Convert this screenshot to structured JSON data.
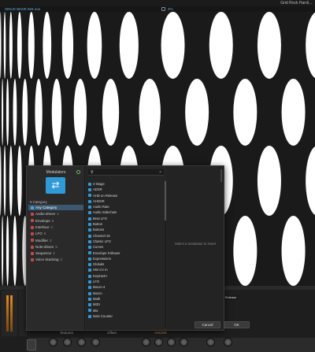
{
  "app": {
    "brand": "Grid Rock Hardi..."
  },
  "track": {
    "name": "SINUS WAVE 5e6 ooo",
    "percent": "2%"
  },
  "dialog": {
    "title": "Modulators",
    "categories_header": "Category",
    "categories": [
      {
        "label": "Any Category",
        "count": "",
        "selected": true,
        "icon": "all-icon"
      },
      {
        "label": "Audio-driven",
        "count": "4",
        "selected": false,
        "icon": "category-icon"
      },
      {
        "label": "Envelope",
        "count": "6",
        "selected": false,
        "icon": "category-icon"
      },
      {
        "label": "Interface",
        "count": "2",
        "selected": false,
        "icon": "category-icon"
      },
      {
        "label": "LFO",
        "count": "6",
        "selected": false,
        "icon": "category-icon"
      },
      {
        "label": "Modifier",
        "count": "3",
        "selected": false,
        "icon": "category-icon"
      },
      {
        "label": "Note-driven",
        "count": "9",
        "selected": false,
        "icon": "category-icon"
      },
      {
        "label": "Sequence",
        "count": "2",
        "selected": false,
        "icon": "category-icon"
      },
      {
        "label": "Voice Stacking",
        "count": "2",
        "selected": false,
        "icon": "category-icon"
      }
    ],
    "search": {
      "value": "",
      "placeholder": ""
    },
    "modulators": [
      "4-Stage",
      "ADSR",
      "AHD on Release",
      "AHDSR",
      "Audio Rate",
      "Audio Sidechain",
      "Beat LFO",
      "Button",
      "Buttons",
      "Channel-16",
      "Classic LFO",
      "Curves",
      "Envelope Follower",
      "Expressions",
      "Globals",
      "HW CV In",
      "Keytrack+",
      "LFO",
      "Macro-4",
      "Macro",
      "Math",
      "MIDI",
      "Mix",
      "Note Counter"
    ],
    "detail_hint": "Select a modulator to insert",
    "cancel_label": "Cancel",
    "ok_label": "OK"
  },
  "dock": {
    "release_label": "Release",
    "textures_label": "Textures",
    "voice_label": "Voices",
    "knob_labels": [
      "Glide",
      "5.13%",
      "Stereo",
      "Width"
    ],
    "offset_label": "Offset",
    "ahdsr_label": "AHDSR"
  }
}
